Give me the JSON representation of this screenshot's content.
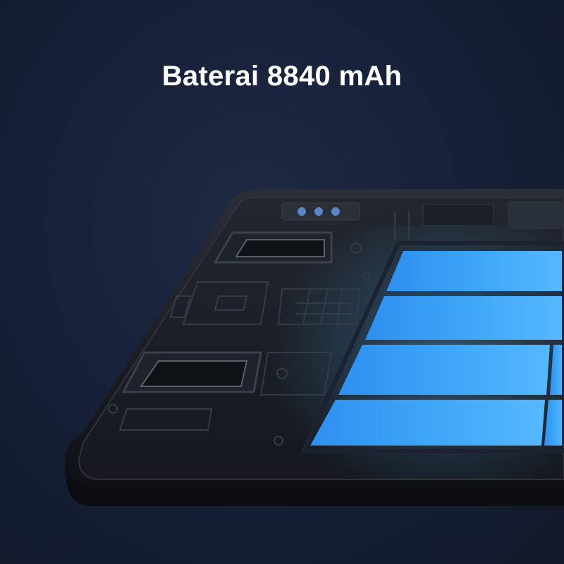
{
  "headline": "Baterai 8840 mAh",
  "palette": {
    "background": "#161f36",
    "tablet_body": "#1a1d24",
    "battery_cells": "#3aa4f5",
    "battery_glow": "#7cc8ff"
  },
  "illustration": {
    "subject": "tablet-internals",
    "icons": [
      "camera-module-icon",
      "speaker-module-icon",
      "battery-cell-icon"
    ]
  }
}
